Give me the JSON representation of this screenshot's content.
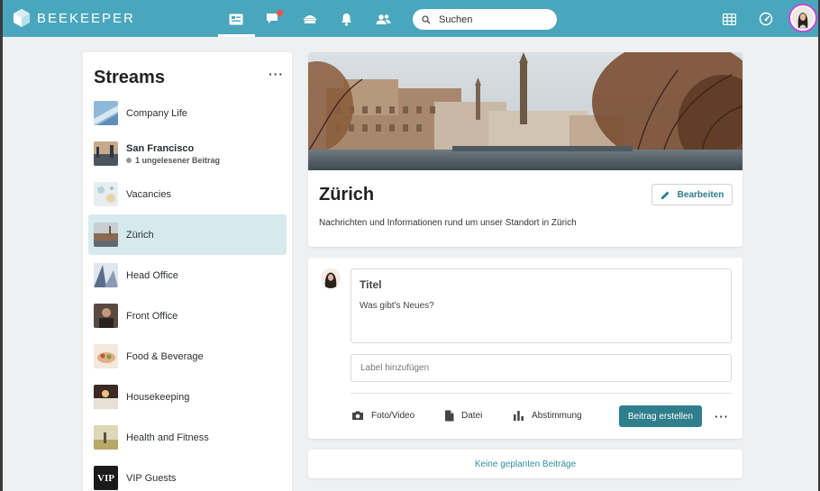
{
  "app": {
    "brand": "BEEKEEPER",
    "colors": {
      "topbar": "#4aa6bc",
      "accent": "#2f7e8c",
      "active_stream": "#d6eaee",
      "badge": "#e8534a"
    }
  },
  "topbar": {
    "nav": [
      {
        "name": "streams-icon",
        "active": true
      },
      {
        "name": "chat-icon",
        "badge": true
      },
      {
        "name": "campus-icon"
      },
      {
        "name": "bell-icon"
      },
      {
        "name": "people-icon"
      }
    ],
    "search": {
      "placeholder": "Suchen",
      "value": ""
    },
    "right_icons": [
      "apps-grid-icon",
      "speedometer-icon",
      "user-avatar"
    ]
  },
  "sidebar": {
    "title": "Streams",
    "more": "···",
    "items": [
      {
        "label": "Company Life",
        "thumb": "company"
      },
      {
        "label": "San Francisco",
        "bold": true,
        "sub": "1 ungelesener Beitrag",
        "thumb": "sf"
      },
      {
        "label": "Vacancies",
        "thumb": "vacancies"
      },
      {
        "label": "Zürich",
        "active": true,
        "thumb": "zurich"
      },
      {
        "label": "Head Office",
        "thumb": "head"
      },
      {
        "label": "Front Office",
        "thumb": "front"
      },
      {
        "label": "Food & Beverage",
        "thumb": "food"
      },
      {
        "label": "Housekeeping",
        "thumb": "house"
      },
      {
        "label": "Health and Fitness",
        "thumb": "health"
      },
      {
        "label": "VIP Guests",
        "thumb": "vip",
        "thumb_text": "VIP"
      }
    ]
  },
  "stream_header": {
    "title": "Zürich",
    "edit_label": "Bearbeiten",
    "description": "Nachrichten und Informationen rund um unser Standort in Zürich"
  },
  "composer": {
    "title_placeholder": "Titel",
    "body_placeholder": "Was gibt's Neues?",
    "label_placeholder": "Label hinzufügen",
    "actions": {
      "photo": "Foto/Video",
      "file": "Datei",
      "poll": "Abstimmung"
    },
    "submit": "Beitrag erstellen",
    "more": "···"
  },
  "scheduled": {
    "label": "Keine geplanten Beiträge"
  }
}
